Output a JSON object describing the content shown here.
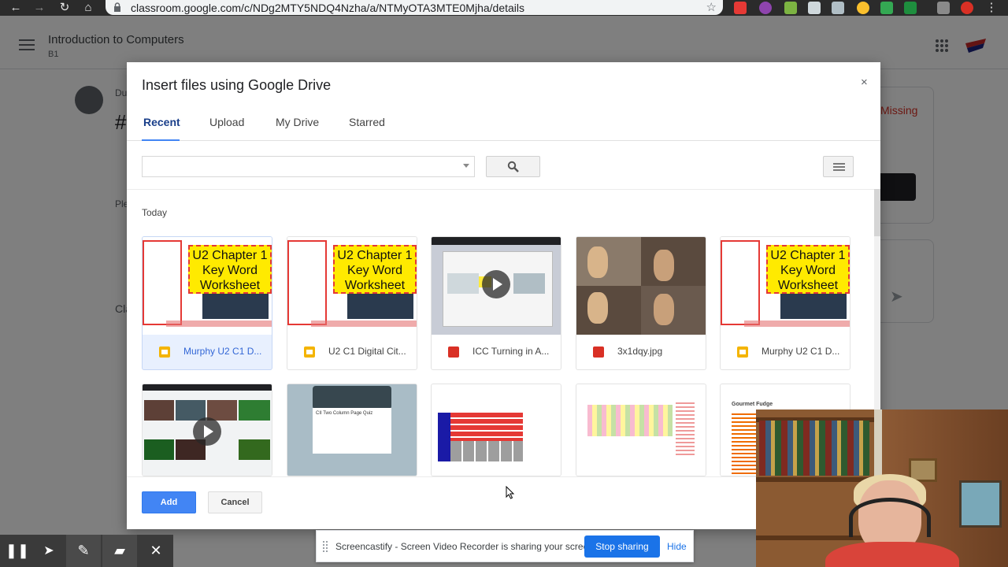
{
  "browser": {
    "url": "classroom.google.com/c/NDg2MTY5NDQ4Nzha/a/NTMyOTA3MTE0Mjha/details"
  },
  "classroom": {
    "course_title": "Introduction to Computers",
    "course_section": "B1",
    "partial_due": "Du",
    "partial_hash": "#",
    "partial_please": "Ple",
    "partial_class": "Cla",
    "status_missing": "Missing"
  },
  "dialog": {
    "title": "Insert files using Google Drive",
    "close_glyph": "×",
    "tabs": [
      {
        "label": "Recent",
        "active": true
      },
      {
        "label": "Upload",
        "active": false
      },
      {
        "label": "My Drive",
        "active": false
      },
      {
        "label": "Starred",
        "active": false
      }
    ],
    "section_label": "Today",
    "files_row1": [
      {
        "name": "Murphy U2 C1 D...",
        "type": "slides",
        "selected": true,
        "thumb_text": "U2 Chapter 1 Key Word Worksheet"
      },
      {
        "name": "U2 C1 Digital Cit...",
        "type": "slides",
        "selected": false,
        "thumb_text": "U2 Chapter 1 Key Word Worksheet"
      },
      {
        "name": "ICC Turning in A...",
        "type": "video",
        "selected": false,
        "thumb_text": ""
      },
      {
        "name": "3x1dqy.jpg",
        "type": "image",
        "selected": false,
        "thumb_text": ""
      },
      {
        "name": "Murphy U2 C1 D...",
        "type": "slides",
        "selected": false,
        "thumb_text": "U2 Chapter 1 Key Word Worksheet"
      }
    ],
    "files_row2_thumb_texts": [
      "",
      "CII Two Column Page Quiz",
      "",
      "",
      "Gourmet Fudge"
    ],
    "add_label": "Add",
    "cancel_label": "Cancel"
  },
  "share_bar": {
    "message": "Screencastify - Screen Video Recorder is sharing your screen.",
    "stop_label": "Stop sharing",
    "hide_label": "Hide"
  },
  "colors": {
    "accent": "#4285f4",
    "active_tab_text": "#1a3f8a",
    "missing_red": "#d93025",
    "worksheet_yellow": "#ffea00"
  },
  "icons": [
    "back-icon",
    "forward-icon",
    "reload-icon",
    "home-icon",
    "lock-icon",
    "star-icon",
    "search-icon",
    "list-view-icon",
    "slides-icon",
    "video-icon",
    "image-icon",
    "play-icon",
    "pause-icon",
    "cursor-icon",
    "pen-icon",
    "highlighter-icon",
    "close-icon"
  ]
}
